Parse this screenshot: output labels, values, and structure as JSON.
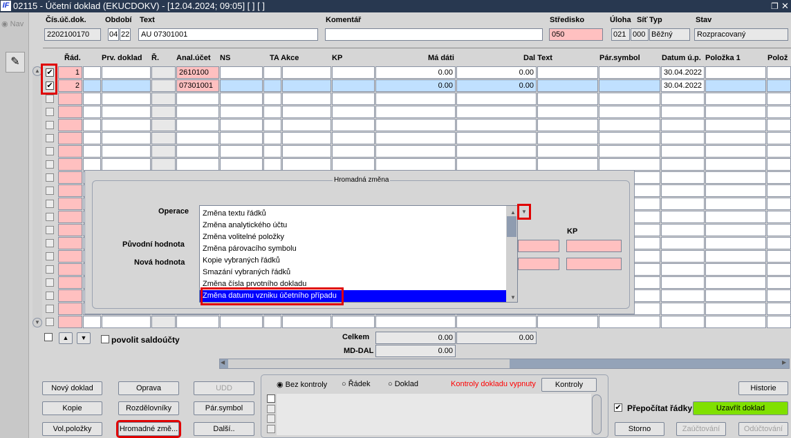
{
  "window": {
    "title": "02115 - Účetní doklad (EKUCDOKV) - [12.04.2024; 09:05] [ ] [ ]",
    "logo": "IF",
    "restore_icon": "restore-icon",
    "close_icon": "close-icon"
  },
  "nav": {
    "label": "Nav"
  },
  "header": {
    "cis_label": "Čís.úč.dok.",
    "cis_value": "2202100170",
    "obdobi_label": "Období",
    "obdobi_month": "04",
    "obdobi_year": "22",
    "text_label": "Text",
    "text_value": "AU 07301001",
    "komentar_label": "Komentář",
    "komentar_value": "",
    "stredisko_label": "Středisko",
    "stredisko_value": "050",
    "uloha_label": "Úloha",
    "uloha_value": "021",
    "sit_label": "Síť",
    "sit_value": "000",
    "typ_label": "Typ",
    "typ_value": "Běžný",
    "stav_label": "Stav",
    "stav_value": "Rozpracovaný"
  },
  "grid": {
    "columns": [
      "Řád.",
      "Prv. doklad",
      "Ř.",
      "Anal.účet",
      "NS",
      "TA Akce",
      "KP",
      "Má dáti",
      "Dal Text",
      "Pár.symbol",
      "Datum ú.p.",
      "Položka 1",
      "Polož"
    ],
    "rows": [
      {
        "checked": true,
        "rad": "1",
        "anal": "2610100",
        "ma_dati": "0.00",
        "dal": "0.00",
        "datum": "30.04.2022"
      },
      {
        "checked": true,
        "rad": "2",
        "anal": "07301001",
        "ma_dati": "0.00",
        "dal": "0.00",
        "datum": "30.04.2022"
      }
    ],
    "empty_rows": 18
  },
  "dialog": {
    "title": "Hromadná změna",
    "operace_label": "Operace",
    "puvodni_label": "Původní hodnota",
    "nova_label": "Nová hodnota",
    "kp_label": "KP",
    "options": [
      "Změna textu řádků",
      "Změna analytického účtu",
      "Změna volitelné položky",
      "Změna párovacího symbolu",
      "Kopie vybraných řádků",
      "Smazání vybraných řádků",
      "Změna čísla prvotního dokladu",
      "Změna datumu vzniku účetního případu"
    ],
    "selected_option": "Změna datumu vzniku účetního případu"
  },
  "footer": {
    "povolit_label": "povolit saldoúčty",
    "celkem_label": "Celkem",
    "celkem_md": "0.00",
    "celkem_dal": "0.00",
    "mddal_label": "MD-DAL",
    "mddal_value": "0.00"
  },
  "buttons": {
    "novy": "Nový doklad",
    "oprava": "Oprava",
    "udd": "UDD",
    "kopie": "Kopie",
    "rozdelovniky": "Rozdělovníky",
    "parsymbol": "Pár.symbol",
    "volpolozky": "Vol.položky",
    "hromadne": "Hromadné změ...",
    "dalsi": "Další..",
    "kontroly": "Kontroly",
    "historie": "Historie",
    "uzavrit": "Uzavřít doklad",
    "storno": "Storno",
    "zauctovani": "Zaúčtování",
    "oductovani": "Odúčtování"
  },
  "kontroly": {
    "bez": "Bez kontroly",
    "radek": "Řádek",
    "doklad": "Doklad",
    "status": "Kontroly dokladu vypnuty",
    "selected": "Bez kontroly"
  },
  "prepocitat": {
    "label": "Přepočítat řádky",
    "checked": true
  },
  "colors": {
    "accent": "#0000ff",
    "green": "#80e000",
    "error": "#ff0000"
  }
}
